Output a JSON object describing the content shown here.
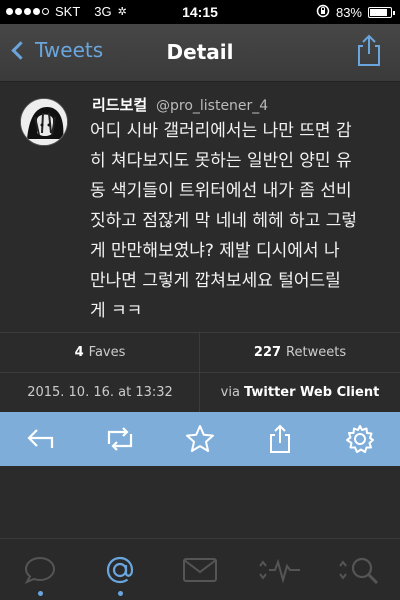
{
  "status_bar": {
    "carrier": "SKT",
    "network": "3G",
    "time": "14:15",
    "battery": "83%",
    "battery_level": 0.83,
    "signal_bars": 4
  },
  "nav": {
    "back_label": "Tweets",
    "title": "Detail"
  },
  "tweet": {
    "user_name": "리드보컬",
    "handle": "@pro_listener_4",
    "text_lines": [
      "어디 시바 갤러리에서는 나만 뜨면 감",
      "히 쳐다보지도 못하는 일반인 양민 유",
      "동 색기들이 트위터에선 내가 좀 선비",
      "짓하고 점잖게 막 네네 헤헤 하고 그렇",
      "게 만만해보였냐? 제발 디시에서 나",
      "만나면 그렇게 깝쳐보세요 털어드릴",
      "게 ㅋㅋ"
    ],
    "faves_count": "4",
    "faves_label": "Faves",
    "retweets_count": "227",
    "retweets_label": "Retweets",
    "date": "2015. 10. 16. at 13:32",
    "via_prefix": "via",
    "via_client": "Twitter Web Client"
  },
  "actions": [
    "reply-icon",
    "retweet-icon",
    "favorite-star-icon",
    "share-icon",
    "settings-gear-icon"
  ],
  "tabs": [
    "timeline-bubble-icon",
    "mentions-at-icon",
    "messages-envelope-icon",
    "activity-pulse-icon",
    "search-magnifier-icon"
  ],
  "colors": {
    "accent": "#6aa6dd",
    "action_bar": "#7eadd9",
    "background": "#2b2b2b"
  }
}
